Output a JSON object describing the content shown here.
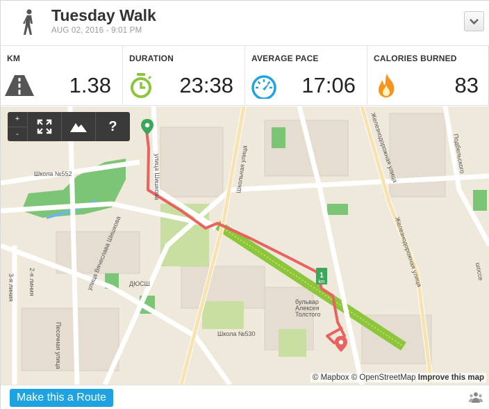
{
  "header": {
    "title": "Tuesday Walk",
    "date": "AUG 02, 2016",
    "separator": "-",
    "time": "9:01 PM",
    "activity_icon": "walker-icon",
    "dropdown_icon": "chevron-down-icon"
  },
  "stats": [
    {
      "label": "KM",
      "value": "1.38",
      "icon": "road-icon",
      "color": "#555555"
    },
    {
      "label": "DURATION",
      "value": "23:38",
      "icon": "stopwatch-icon",
      "color": "#8cc63f"
    },
    {
      "label": "AVERAGE PACE",
      "value": "17:06",
      "icon": "speedometer-icon",
      "color": "#1ea3e0"
    },
    {
      "label": "CALORIES BURNED",
      "value": "83",
      "icon": "flame-icon",
      "color": "#f7941d"
    }
  ],
  "map": {
    "controls": {
      "zoom_in": "+",
      "zoom_out": "-",
      "fullscreen_icon": "fullscreen-icon",
      "terrain_icon": "mountain-icon",
      "help": "?"
    },
    "labels": {
      "school552": "Школа №552",
      "school530": "Школа №530",
      "dyush": "ДЮСШ",
      "boulevard_1": "бульвар",
      "boulevard_2": "Алексея",
      "boulevard_3": "Толстого",
      "km_marker": "1",
      "km_unit": "km",
      "street_shishkova": "улица Вячеслава Шишкова",
      "street_shishkova_top": "улица Шишкова",
      "street_shkolnaya": "Школьная улица",
      "street_zheleznodor": "Железнодорожная улица",
      "street_zheleznodor_top": "Железнодорожная улица",
      "street_pesochnaya": "Песочная улица",
      "street_3liniya": "3-я линия",
      "street_2liniya": "2-я линия",
      "street_podbelskogo": "Подбельского",
      "street_shosse": "шоссе"
    },
    "attribution": {
      "mapbox": "© Mapbox",
      "osm": "© OpenStreetMap",
      "improve": "Improve this map"
    },
    "route_color": "#e8635f",
    "park_color": "#8cc63f"
  },
  "footer": {
    "route_button": "Make this a Route",
    "people_icon": "people-icon"
  }
}
